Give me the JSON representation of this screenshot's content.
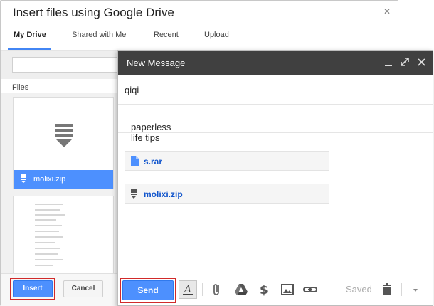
{
  "picker": {
    "title": "Insert files using Google Drive",
    "tabs": [
      {
        "label": "My Drive",
        "active": true
      },
      {
        "label": "Shared with Me",
        "active": false
      },
      {
        "label": "Recent",
        "active": false
      },
      {
        "label": "Upload",
        "active": false
      }
    ],
    "files_label": "Files",
    "files": [
      {
        "name": "molixi.zip",
        "selected": true,
        "icon": "zip-file-icon"
      },
      {
        "name": "",
        "selected": false,
        "icon": "document-thumbnail"
      }
    ],
    "insert_label": "Insert",
    "cancel_label": "Cancel",
    "close_icon": "close-icon"
  },
  "compose": {
    "title": "New Message",
    "to": "qiqi",
    "subject": "paperless life tips",
    "attachments": [
      {
        "name": "s.rar",
        "icon": "document-icon"
      },
      {
        "name": "molixi.zip",
        "icon": "zip-icon"
      }
    ],
    "send_label": "Send",
    "saved_label": "Saved",
    "toolbar_icons": [
      "format-text-icon",
      "attach-icon",
      "drive-icon",
      "money-icon",
      "photo-icon",
      "link-icon",
      "trash-icon",
      "more-options-icon"
    ]
  },
  "colors": {
    "accent": "#4d90fe",
    "header": "#404040",
    "highlight": "#d12a2a",
    "link": "#15c"
  }
}
